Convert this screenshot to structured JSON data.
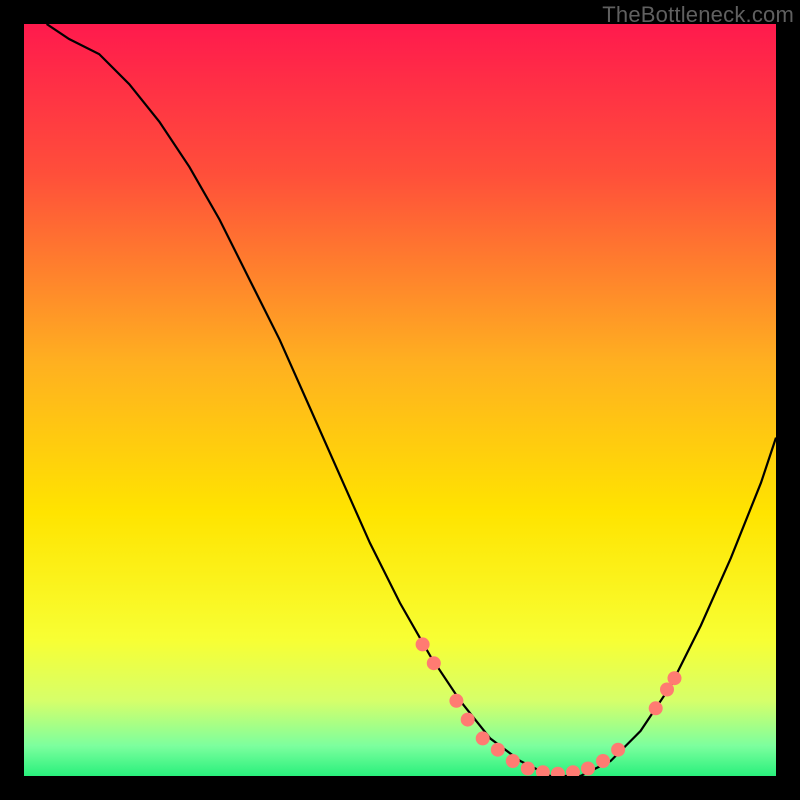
{
  "watermark": "TheBottleneck.com",
  "chart_data": {
    "type": "line",
    "title": "",
    "xlabel": "",
    "ylabel": "",
    "xlim": [
      0,
      100
    ],
    "ylim": [
      0,
      100
    ],
    "grid": false,
    "legend": false,
    "background_gradient": {
      "stops": [
        {
          "offset": 0.0,
          "color": "#ff1a4d"
        },
        {
          "offset": 0.2,
          "color": "#ff4f3a"
        },
        {
          "offset": 0.45,
          "color": "#ffb020"
        },
        {
          "offset": 0.65,
          "color": "#ffe400"
        },
        {
          "offset": 0.82,
          "color": "#f7ff34"
        },
        {
          "offset": 0.9,
          "color": "#d6ff6a"
        },
        {
          "offset": 0.96,
          "color": "#7cff9e"
        },
        {
          "offset": 1.0,
          "color": "#29f07c"
        }
      ]
    },
    "series": [
      {
        "name": "curve",
        "color": "#000000",
        "x": [
          3,
          6,
          10,
          14,
          18,
          22,
          26,
          30,
          34,
          38,
          42,
          46,
          50,
          54,
          58,
          62,
          66,
          70,
          74,
          78,
          82,
          86,
          90,
          94,
          98,
          100
        ],
        "y": [
          100,
          98,
          96,
          92,
          87,
          81,
          74,
          66,
          58,
          49,
          40,
          31,
          23,
          16,
          10,
          5,
          2,
          0,
          0,
          2,
          6,
          12,
          20,
          29,
          39,
          45
        ]
      }
    ],
    "markers": {
      "color": "#ff7b72",
      "radius": 7,
      "points": [
        {
          "x": 53,
          "y": 17.5
        },
        {
          "x": 54.5,
          "y": 15
        },
        {
          "x": 57.5,
          "y": 10
        },
        {
          "x": 59,
          "y": 7.5
        },
        {
          "x": 61,
          "y": 5
        },
        {
          "x": 63,
          "y": 3.5
        },
        {
          "x": 65,
          "y": 2
        },
        {
          "x": 67,
          "y": 1
        },
        {
          "x": 69,
          "y": 0.5
        },
        {
          "x": 71,
          "y": 0.3
        },
        {
          "x": 73,
          "y": 0.5
        },
        {
          "x": 75,
          "y": 1
        },
        {
          "x": 77,
          "y": 2
        },
        {
          "x": 79,
          "y": 3.5
        },
        {
          "x": 84,
          "y": 9
        },
        {
          "x": 85.5,
          "y": 11.5
        },
        {
          "x": 86.5,
          "y": 13
        }
      ]
    }
  }
}
